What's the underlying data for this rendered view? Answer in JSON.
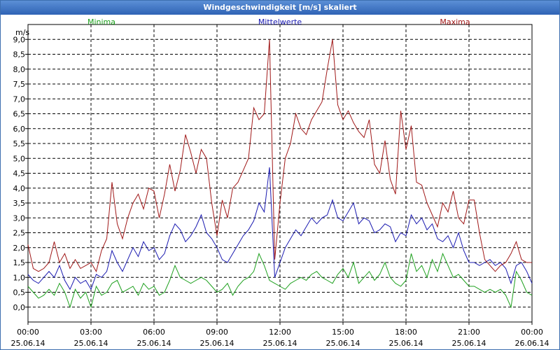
{
  "window": {
    "title": "Windgeschwindigkeit [m/s] skaliert"
  },
  "chart_data": {
    "type": "line",
    "title": "Windgeschwindigkeit [m/s] skaliert",
    "ylabel": "m/s",
    "ylim": [
      -0.5,
      9.5
    ],
    "y_ticks": [
      "0,0",
      "0,5",
      "1,0",
      "1,5",
      "2,0",
      "2,5",
      "3,0",
      "3,5",
      "4,0",
      "4,5",
      "5,0",
      "5,5",
      "6,0",
      "6,5",
      "7,0",
      "7,5",
      "8,0",
      "8,5",
      "9,0"
    ],
    "x_ticks": [
      {
        "time": "00:00",
        "date": "25.06.14"
      },
      {
        "time": "03:00",
        "date": "25.06.14"
      },
      {
        "time": "06:00",
        "date": "25.06.14"
      },
      {
        "time": "09:00",
        "date": "25.06.14"
      },
      {
        "time": "12:00",
        "date": "25.06.14"
      },
      {
        "time": "15:00",
        "date": "25.06.14"
      },
      {
        "time": "18:00",
        "date": "25.06.14"
      },
      {
        "time": "21:00",
        "date": "25.06.14"
      },
      {
        "time": "00:00",
        "date": "26.06.14"
      }
    ],
    "grid": true,
    "x_hours": [
      0,
      0.25,
      0.5,
      0.75,
      1,
      1.25,
      1.5,
      1.75,
      2,
      2.25,
      2.5,
      2.75,
      3,
      3.25,
      3.5,
      3.75,
      4,
      4.25,
      4.5,
      4.75,
      5,
      5.25,
      5.5,
      5.75,
      6,
      6.25,
      6.5,
      6.75,
      7,
      7.25,
      7.5,
      7.75,
      8,
      8.25,
      8.5,
      8.75,
      9,
      9.25,
      9.5,
      9.75,
      10,
      10.25,
      10.5,
      10.75,
      11,
      11.25,
      11.5,
      11.75,
      12,
      12.25,
      12.5,
      12.75,
      13,
      13.25,
      13.5,
      13.75,
      14,
      14.25,
      14.5,
      14.75,
      15,
      15.25,
      15.5,
      15.75,
      16,
      16.25,
      16.5,
      16.75,
      17,
      17.25,
      17.5,
      17.75,
      18,
      18.25,
      18.5,
      18.75,
      19,
      19.25,
      19.5,
      19.75,
      20,
      20.25,
      20.5,
      20.75,
      21,
      21.25,
      21.5,
      21.75,
      22,
      22.25,
      22.5,
      22.75,
      23,
      23.25,
      23.5,
      23.75,
      24
    ],
    "series": [
      {
        "name": "Minima",
        "color": "#1ea01e",
        "values": [
          0.7,
          0.5,
          0.3,
          0.4,
          0.6,
          0.4,
          0.8,
          0.5,
          0.0,
          0.6,
          0.3,
          0.5,
          0.0,
          0.7,
          0.4,
          0.5,
          0.8,
          0.9,
          0.5,
          0.6,
          0.7,
          0.4,
          0.8,
          0.6,
          0.7,
          0.4,
          0.5,
          0.9,
          1.4,
          1.0,
          0.9,
          0.8,
          0.9,
          1.0,
          0.9,
          0.7,
          0.5,
          0.6,
          0.8,
          0.4,
          0.7,
          0.9,
          1.0,
          1.2,
          1.8,
          1.4,
          0.9,
          0.8,
          0.7,
          0.6,
          0.8,
          0.9,
          1.0,
          0.9,
          1.1,
          1.2,
          1.0,
          0.9,
          0.8,
          1.1,
          1.3,
          1.0,
          1.5,
          0.8,
          1.0,
          1.2,
          0.9,
          1.1,
          1.5,
          1.0,
          0.8,
          0.7,
          0.9,
          1.8,
          1.2,
          1.4,
          1.0,
          1.6,
          1.2,
          1.8,
          1.4,
          1.0,
          1.1,
          0.9,
          0.7,
          0.7,
          0.6,
          0.5,
          0.6,
          0.5,
          0.6,
          0.4,
          0.0,
          1.2,
          0.9,
          0.5,
          0.4
        ]
      },
      {
        "name": "Mittelwerte",
        "color": "#1a1ab0",
        "values": [
          1.1,
          0.9,
          0.8,
          1.0,
          1.2,
          1.0,
          1.4,
          0.9,
          0.6,
          1.0,
          0.8,
          0.9,
          0.6,
          1.1,
          1.0,
          1.2,
          1.9,
          1.5,
          1.2,
          1.6,
          2.0,
          1.7,
          2.2,
          1.9,
          2.0,
          1.6,
          1.8,
          2.4,
          2.8,
          2.6,
          2.2,
          2.4,
          2.7,
          3.1,
          2.5,
          2.3,
          2.0,
          1.6,
          1.5,
          1.8,
          2.1,
          2.4,
          2.6,
          2.9,
          3.5,
          3.2,
          4.7,
          1.0,
          1.5,
          2.0,
          2.3,
          2.6,
          2.4,
          2.7,
          3.0,
          2.8,
          3.0,
          3.1,
          3.6,
          3.0,
          2.9,
          3.2,
          3.5,
          2.8,
          3.0,
          2.9,
          2.5,
          2.6,
          2.8,
          2.7,
          2.2,
          2.5,
          2.4,
          3.1,
          2.8,
          3.0,
          2.6,
          2.8,
          2.3,
          2.2,
          2.4,
          2.0,
          2.5,
          1.9,
          1.5,
          1.5,
          1.4,
          1.5,
          1.6,
          1.4,
          1.5,
          1.3,
          0.8,
          1.4,
          1.5,
          1.2,
          0.8
        ]
      },
      {
        "name": "Maxima",
        "color": "#a01818",
        "values": [
          2.1,
          1.3,
          1.2,
          1.3,
          1.5,
          2.2,
          1.5,
          1.8,
          1.3,
          1.6,
          1.3,
          1.4,
          1.5,
          1.2,
          1.9,
          2.3,
          4.2,
          2.8,
          2.3,
          3.0,
          3.5,
          3.8,
          3.3,
          4.0,
          3.9,
          3.0,
          3.8,
          4.8,
          3.9,
          4.6,
          5.8,
          5.2,
          4.5,
          5.3,
          5.0,
          3.5,
          2.4,
          3.6,
          3.0,
          4.0,
          4.2,
          4.6,
          5.0,
          6.7,
          6.3,
          6.5,
          9.0,
          1.6,
          3.5,
          5.0,
          5.5,
          6.5,
          6.0,
          5.8,
          6.3,
          6.6,
          6.9,
          8.0,
          9.0,
          6.8,
          6.3,
          6.6,
          6.2,
          5.9,
          5.7,
          6.3,
          4.8,
          4.5,
          5.6,
          4.3,
          3.8,
          6.6,
          5.3,
          6.1,
          4.2,
          4.1,
          3.5,
          3.1,
          2.7,
          3.5,
          3.2,
          3.9,
          3.0,
          2.8,
          3.6,
          3.6,
          2.5,
          1.6,
          1.4,
          1.2,
          1.4,
          1.5,
          1.8,
          2.2,
          1.6,
          1.5,
          1.5
        ]
      }
    ]
  }
}
